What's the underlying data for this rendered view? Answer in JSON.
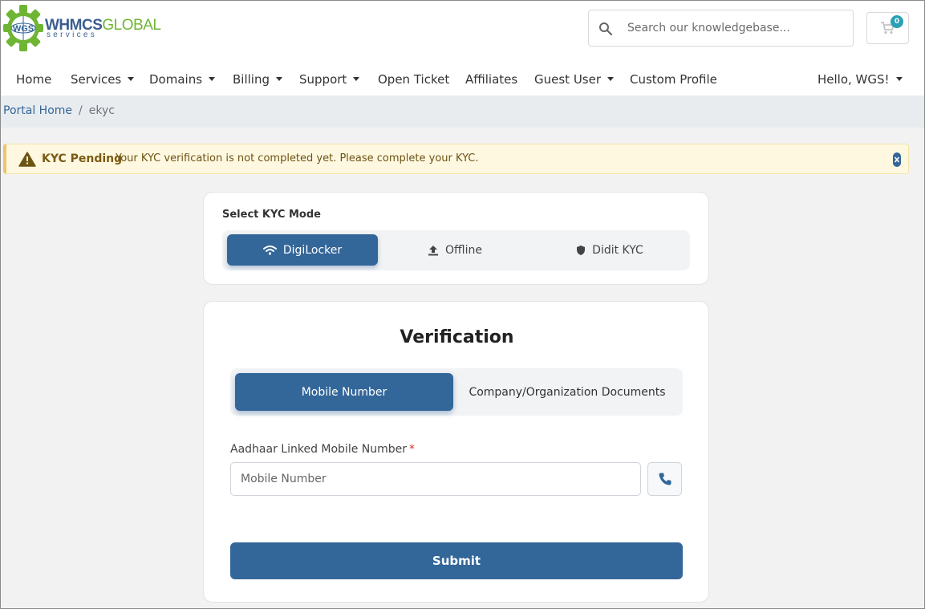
{
  "brand": {
    "badge": "WGS",
    "name_part1": "WHMCS",
    "name_part2": "GLOBAL",
    "tagline": "services",
    "colors": {
      "primary": "#336699",
      "accent_green": "#6fb534"
    }
  },
  "search": {
    "placeholder": "Search our knowledgebase...",
    "icon": "search-icon"
  },
  "cart": {
    "count": "0",
    "icon": "cart-icon"
  },
  "nav": {
    "home": "Home",
    "services": "Services",
    "domains": "Domains",
    "billing": "Billing",
    "support": "Support",
    "open_ticket": "Open Ticket",
    "affiliates": "Affiliates",
    "guest_user": "Guest User",
    "custom_profile": "Custom Profile",
    "greeting": "Hello, WGS!"
  },
  "breadcrumb": {
    "home": "Portal Home",
    "separator": "/",
    "current": "ekyc"
  },
  "alert": {
    "title": "KYC Pending",
    "message": "Your KYC verification is not completed yet. Please complete your KYC.",
    "icon": "warning-icon"
  },
  "kyc_mode": {
    "label": "Select KYC Mode",
    "tabs": [
      {
        "label": "DigiLocker",
        "icon": "wifi-icon",
        "active": true
      },
      {
        "label": "Offline",
        "icon": "upload-icon",
        "active": false
      },
      {
        "label": "Didit KYC",
        "icon": "shield-icon",
        "active": false
      }
    ]
  },
  "verification": {
    "title": "Verification",
    "tabs": [
      {
        "label": "Mobile Number",
        "active": true
      },
      {
        "label": "Company/Organization Documents",
        "active": false
      }
    ],
    "field_label": "Aadhaar Linked Mobile Number",
    "required_mark": "*",
    "input_placeholder": "Mobile Number",
    "input_value": "",
    "submit_label": "Submit"
  }
}
